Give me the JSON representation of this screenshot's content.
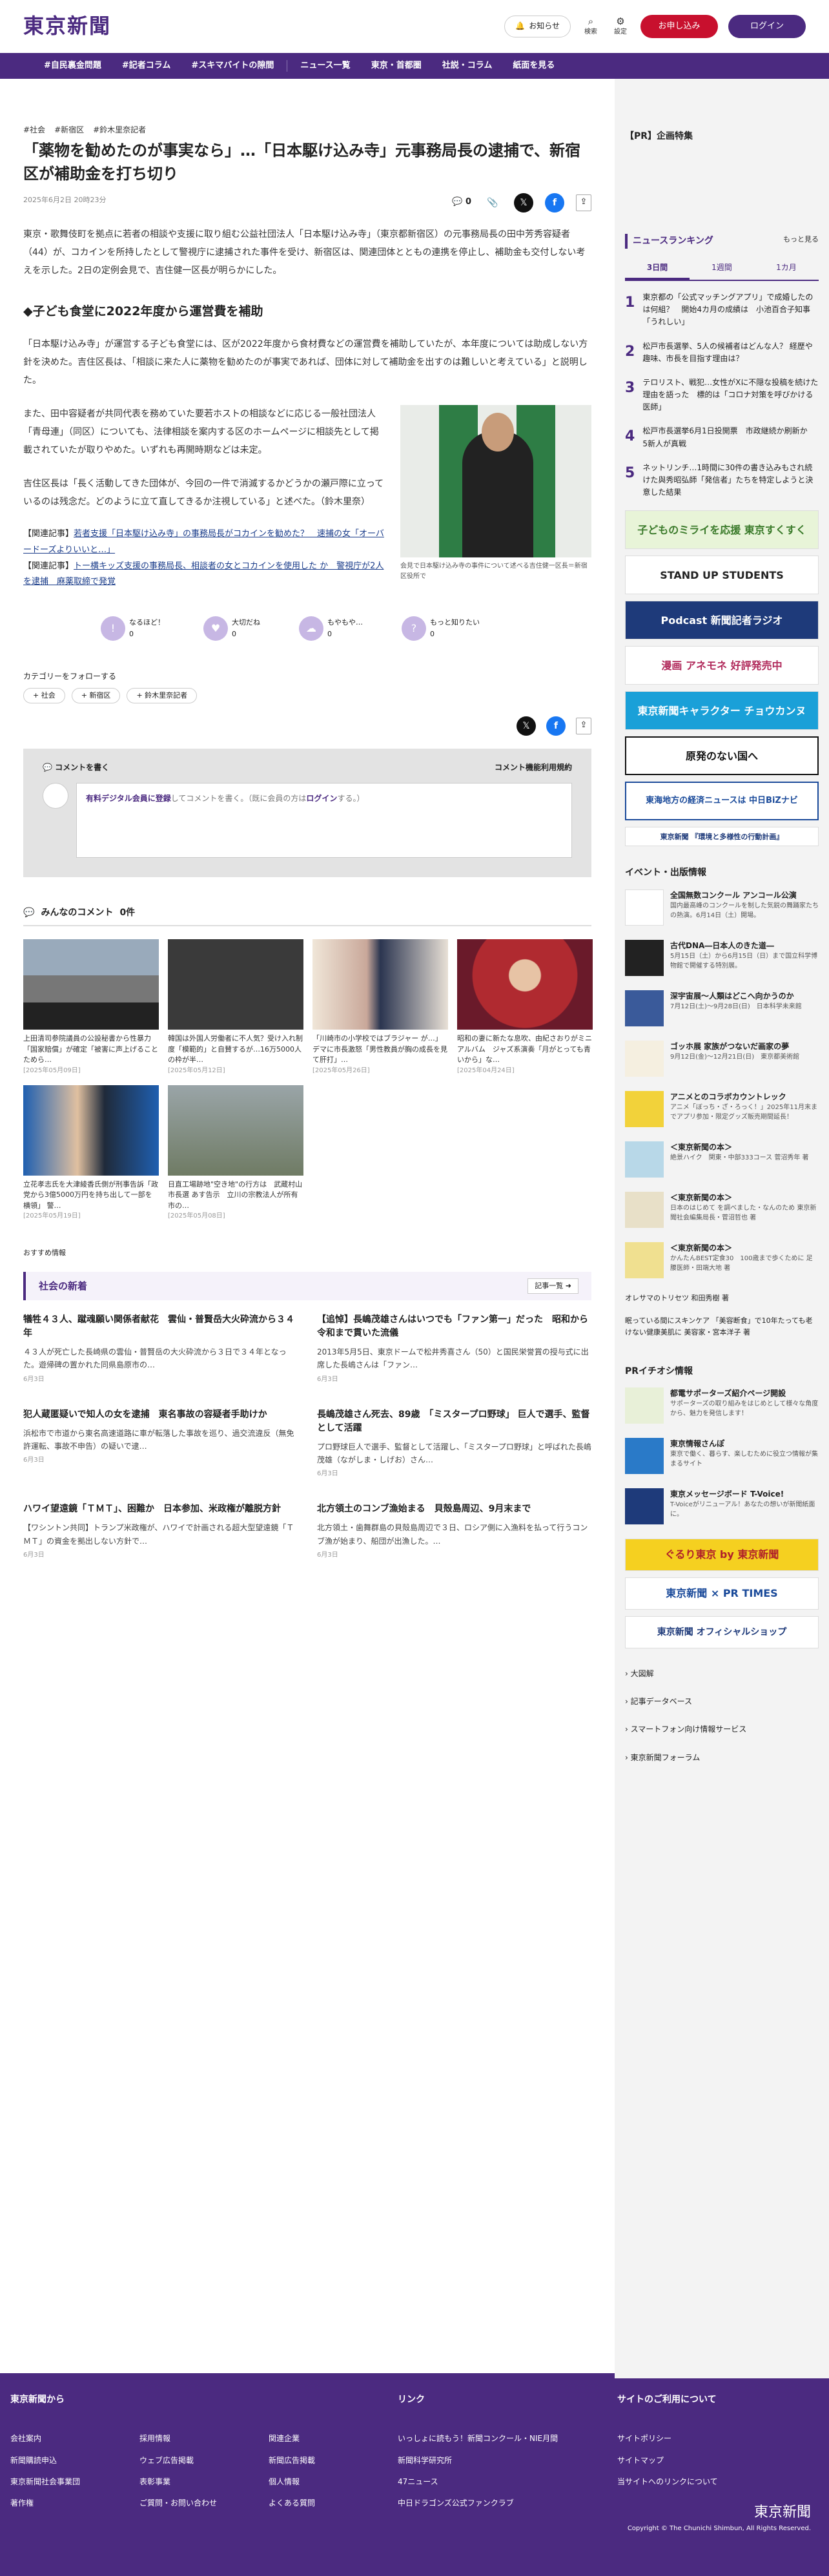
{
  "header": {
    "logo": "東京新聞",
    "notice": "お知らせ",
    "search": "検索",
    "settings": "設定",
    "apply": "お申し込み",
    "login": "ログイン"
  },
  "nav": [
    "#自民裏金問題",
    "#記者コラム",
    "#スキマバイトの隙間",
    "ニュース一覧",
    "東京・首都圏",
    "社説・コラム",
    "紙面を見る"
  ],
  "article": {
    "tags": [
      "#社会",
      "#新宿区",
      "#鈴木里奈記者"
    ],
    "title": "「薬物を勧めたのが事実なら」…「日本駆け込み寺」元事務局長の逮捕で、新宿区が補助金を打ち切り",
    "date": "2025年6月2日 20時23分",
    "comment_count": "0",
    "p1": "東京・歌舞伎町を拠点に若者の相談や支援に取り組む公益社団法人「日本駆け込み寺」（東京都新宿区）の元事務局長の田中芳秀容疑者（44）が、コカインを所持したとして警視庁に逮捕された事件を受け、新宿区は、関連団体とともの連携を停止し、補助金も交付しない考えを示した。2日の定例会見で、吉住健一区長が明らかにした。",
    "h2": "◆子ども食堂に2022年度から運営費を補助",
    "p2": "「日本駆け込み寺」が運営する子ども食堂には、区が2022年度から食材費などの運営費を補助していたが、本年度については助成しない方針を決めた。吉住区長は、「相談に来た人に薬物を勧めたのが事実であれば、団体に対して補助金を出すのは難しいと考えている」と説明した。",
    "p3": "また、田中容疑者が共同代表を務めていた要若ホストの相談などに応じる一般社団法人「青母連」（同区）についても、法律相談を案内する区のホームページに相談先として掲載されていたが取りやめた。いずれも再開時期などは未定。",
    "p4": "吉住区長は「長く活動してきた団体が、今回の一件で消滅するかどうかの瀬戸際に立っているのは残念だ。どのように立て直してきるか注視している」と述べた。（鈴木里奈）",
    "related1_prefix": "【関連記事】",
    "related1": "若者支援「日本駆け込み寺」の事務局長がコカインを勧めた？　速捕の女「オーバードーズよりいいと…」",
    "related2_prefix": "【関連記事】",
    "related2": "トー横キッズ支援の事務局長、相談者の女とコカインを使用した か　警視庁が2人を逮捕　麻薬取締で発覚",
    "caption": "会見で日本駆け込み寺の事件について述べる吉住健一区長＝新宿区役所で"
  },
  "reactions": [
    {
      "label": "なるほど！",
      "count": "0"
    },
    {
      "label": "大切だね",
      "count": "0"
    },
    {
      "label": "もやもや…",
      "count": "0"
    },
    {
      "label": "もっと知りたい",
      "count": "0"
    }
  ],
  "follow": {
    "title": "カテゴリーをフォローする",
    "chips": [
      "社会",
      "新宿区",
      "鈴木里奈記者"
    ]
  },
  "comment_box": {
    "title": "コメントを書く",
    "policy": "コメント機能利用規約",
    "member": "有料デジタル会員に登録",
    "rest": "してコメントを書く。（既に会員の方は",
    "login": "ログイン",
    "end": "する。）"
  },
  "comments": {
    "title": "みんなのコメント",
    "count": "0件"
  },
  "cards": [
    {
      "t": "上田清司参院議員の公設秘書から性暴力「国家賠償」が確定「被害に声上げることためら…",
      "d": "[2025年05月09日]"
    },
    {
      "t": "韓国は外国人労働者に不人気？受け入れ制度「模範的」と自賛するが…16万5000人の枠が半…",
      "d": "[2025年05月12日]"
    },
    {
      "t": "「川崎市の小学校ではブラジャー が…」　デマに市長激怒「男性教員が胸の成長を見て肝打」…",
      "d": "[2025年05月26日]"
    },
    {
      "t": "昭和の妻に新たな息吹、由紀さおりがミニアルバム　ジャズ系演奏「月がとっても青いから」な…",
      "d": "[2025年04月24日]"
    },
    {
      "t": "立花孝志氏を大津綾香氏側が刑事告訴「政党から3億5000万円を持ち出して一部を横領」 警…",
      "d": "[2025年05月19日]"
    },
    {
      "t": "日直工場跡地\"空き地\"の行方は　武蔵村山市長選 あす告示　立川の宗教法人が所有　市の…",
      "d": "[2025年05月08日]"
    }
  ],
  "reco": "おすすめ情報",
  "news": {
    "title": "社会の新着",
    "more": "記事一覧",
    "items": [
      {
        "h": "犠牲４３人、蹴魂願い関係者献花　雲仙・普賢岳大火砕流から３４年",
        "b": "４３人が死亡した長崎県の雲仙・普賢岳の大火砕流から３日で３４年となった。遊帰碑の置かれた同県島原市の…",
        "d": "6月3日"
      },
      {
        "h": "【追悼】長嶋茂雄さんはいつでも「ファン第一」だった　昭和から令和まで貫いた流儀",
        "b": "2013年5月5日、東京ドームで松井秀喜さん（50）と国民栄誉賞の授与式に出席した長嶋さんは「ファン…",
        "d": "6月3日"
      },
      {
        "h": "犯人蔵匿疑いで知人の女を逮捕　東名事故の容疑者手助けか",
        "b": "浜松市で市道から東名高速道路に車が転落した事故を巡り、過交流違反（無免許運転、事故不申告）の疑いで逮…",
        "d": "6月3日"
      },
      {
        "h": "長嶋茂雄さん死去、89歳　「ミスタープロ野球」 巨人で選手、監督として活躍",
        "b": "プロ野球巨人で選手、監督として活躍し、「ミスタープロ野球」と呼ばれた長嶋茂雄（ながしま・しげお）さん…",
        "d": "6月3日"
      },
      {
        "h": "ハワイ望遠鏡「ＴＭＴ」、困難か　日本参加、米政権が離脱方針",
        "b": "【ワシントン共同】トランプ米政権が、ハワイで計画される超大型望遠鏡「ＴＭＴ」の資金を拠出しない方針で…",
        "d": "6月3日"
      },
      {
        "h": "北方領土のコンブ漁始まる　貝殻島周辺、9月末まで",
        "b": "北方領土・歯舞群島の貝殻島周辺で３日、ロシア側に入漁料を払って行うコンブ漁が始まり、船団が出漁した。…",
        "d": "6月3日"
      }
    ]
  },
  "side": {
    "pr": "【PR】企画特集",
    "rank_title": "ニュースランキング",
    "rank_more": "もっと見る",
    "tabs": [
      "3日間",
      "1週間",
      "1カ月"
    ],
    "ranking": [
      "東京都の「公式マッチングアプリ」で成婚したのは何組？　開始4カ月の成績は　小池百合子知事「うれしい」",
      "松戸市長選挙、5人の候補者はどんな人？ 経歴や趣味、市長を目指す理由は？",
      "テロリスト、戦犯…女性がXに不隠な投稿を続けた理由を語った　標的は「コロナ対策を呼びかける医師」",
      "松戸市長選挙6月1日投開票　市政継続か刷新か　5新人が真戦",
      "ネットリンチ…1時間に30件の書き込みもされ続けた與秀昭弘師「発信者」たちを特定しようと決意した結果"
    ],
    "banners": [
      "子どものミライを応援 東京すくすく",
      "STAND UP STUDENTS",
      "Podcast 新聞記者ラジオ",
      "漫画 アネモネ 好評発売中",
      "東京新聞キャラクター チョウカンヌ",
      "原発のない国へ",
      "東海地方の経済ニュースは 中日BiZナビ",
      "東京新聞 『環境と多様性の行動計画』"
    ],
    "events_title": "イベント・出版情報",
    "events": [
      {
        "t": "全国無数コンクール アンコール公演",
        "s": "国内最高峰のコンクールを制した気鋭の舞踊家たちの熱演。6月14日（土）開場。"
      },
      {
        "t": "古代DNA―日本人のきた道―",
        "s": "5月15日（土）から6月15日（日）まで国立科学博物館で開催する特別展。"
      },
      {
        "t": "深宇宙展〜人類はどこへ向かうのか",
        "s": "7月12日(土)〜9月28日(日)　日本科学未来館"
      },
      {
        "t": "ゴッホ展 家族がつないだ画家の夢",
        "s": "9月12日(金)〜12月21日(日)　東京都美術館"
      },
      {
        "t": "アニメとのコラボカウントレック",
        "s": "アニメ「ぼっち・ざ・ろっく！」2025年11月末までアプリ参加・限定グッズ販売期間延長！"
      },
      {
        "t": "＜東京新聞の本＞",
        "s": "絶景ハイク　関東・中部333コース 菅沼秀年 著"
      },
      {
        "t": "＜東京新聞の本＞",
        "s": "日本のはじめて を調べました・なんのため 東京新聞社会編集局長・菅沼哲也 著"
      },
      {
        "t": "＜東京新聞の本＞",
        "s": "かんたんBEST定食30　100歳まで歩くために 足腰医師・田端大地 著"
      }
    ],
    "book1": "オレサマのトリセツ 和田秀樹 著",
    "book2": "眠っている間にスキンケア 「美容断食」で10年たっても老けない健康美肌に 美容家・宮本洋子 著",
    "prinfo": "PRイチオシ情報",
    "pr_items": [
      {
        "t": "都電サポーターズ紹介ページ開設",
        "s": "サポーターズの取り組みをはじめとして様々な角度から、魅力を発信します！"
      },
      {
        "t": "東京情報さんぽ",
        "s": "東京で働く、暮らす、楽しむために役立つ情報が集まるサイト"
      },
      {
        "t": "東京メッセージボード T-Voice!",
        "s": "T-Voiceがリニューアル！あなたの想いが新聞紙面に。"
      }
    ],
    "pr_banners": [
      "ぐるり東京 by 東京新聞",
      "東京新聞 × PR TIMES",
      "東京新聞 オフィシャルショップ"
    ],
    "links": [
      "大図解",
      "記事データベース",
      "スマートフォン向け情報サービス",
      "東京新聞フォーラム"
    ]
  },
  "footer": {
    "col1_title": "東京新聞から",
    "col1": [
      "会社案内",
      "採用情報",
      "関連企業",
      "新聞購読申込",
      "ウェブ広告掲載",
      "新聞広告掲載",
      "東京新聞社会事業団",
      "表彰事業",
      "個人情報",
      "著作権",
      "ご質問・お問い合わせ",
      "よくある質問"
    ],
    "col2_title": "リンク",
    "col2": [
      "いっしょに読もう！新聞コンクール・NIE月間",
      "新聞科学研究所",
      "47ニュース",
      "中日ドラゴンズ公式ファンクラブ"
    ],
    "col3_title": "サイトのご利用について",
    "col3": [
      "サイトポリシー",
      "サイトマップ",
      "当サイトへのリンクについて"
    ],
    "logo": "東京新聞",
    "copyright": "Copyright © The Chunichi Shimbun, All Rights Reserved."
  }
}
